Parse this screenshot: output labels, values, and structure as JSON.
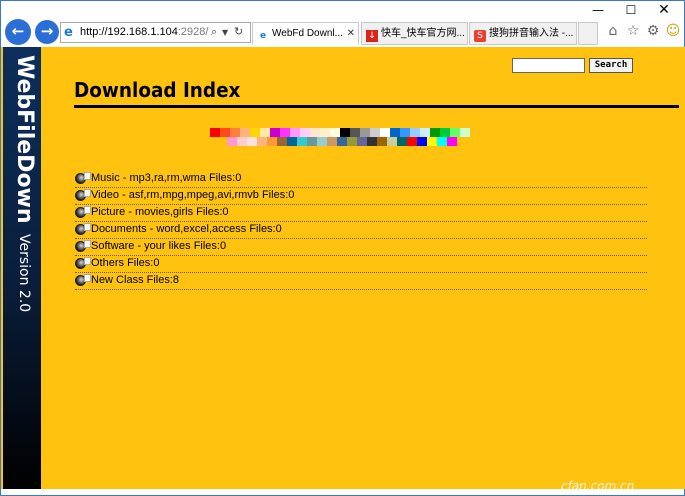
{
  "window": {
    "controls": {
      "minimize": "—",
      "maximize": "☐",
      "close": "✕"
    }
  },
  "toolbar": {
    "back_icon": "←",
    "forward_icon": "→",
    "address": {
      "url_main": "http://192.168.1.104",
      "url_port": ":2928/"
    },
    "tabs": [
      {
        "label": "WebFd Downl...",
        "icon": "page-icon",
        "active": true
      },
      {
        "label": "快车_快车官方网...",
        "icon": "download-icon",
        "active": false
      },
      {
        "label": "搜狗拼音输入法 -...",
        "icon": "sogou-icon",
        "active": false
      }
    ],
    "right_icons": [
      "home-icon",
      "star-icon",
      "gear-icon",
      "smiley-icon"
    ]
  },
  "sidebar": {
    "title": "WebFileDown",
    "version": "Version 2.0"
  },
  "search": {
    "value": "",
    "button_label": "Search"
  },
  "page": {
    "title": "Download Index"
  },
  "palette": {
    "row1": [
      "#ff0000",
      "#ff4a1a",
      "#ff7f3f",
      "#ffb27a",
      "#ffd400",
      "#ffe9a8",
      "#cc00cc",
      "#ff33ff",
      "#ff99ff",
      "#ffccff",
      "#ffe6cc",
      "#fff0cc",
      "#fffbe0",
      "#000000",
      "#555555",
      "#999999",
      "#cccccc",
      "#ffffff",
      "#0066cc",
      "#3399ff",
      "#99ccff",
      "#cceeff",
      "#009900",
      "#00cc33",
      "#66ff66",
      "#ccffcc"
    ],
    "row2": [
      "#ff99cc",
      "#ffcccc",
      "#ffe0e0",
      "#ffb380",
      "#ff9933",
      "#996633",
      "#006699",
      "#33cccc",
      "#669999",
      "#99cccc",
      "#cc9966",
      "#336699",
      "#999933",
      "#666699",
      "#333333",
      "#996600",
      "#cccc99",
      "#006666",
      "#ff0000",
      "#0000ff",
      "#ffff00",
      "#00ffff",
      "#ff00ff"
    ]
  },
  "categories": [
    {
      "label": "Music - mp3,ra,rm,wma Files:0"
    },
    {
      "label": "Video - asf,rm,mpg,mpeg,avi,rmvb Files:0"
    },
    {
      "label": "Picture - movies,girls Files:0"
    },
    {
      "label": "Documents - word,excel,access Files:0"
    },
    {
      "label": "Software - your likes Files:0"
    },
    {
      "label": "Others Files:0"
    },
    {
      "label": "New Class Files:8"
    }
  ],
  "watermark": "cfan.com.cn",
  "colors": {
    "page_bg": "#ffc20e",
    "sidebar": "#0c2f5c",
    "accent": "#2b6fd6"
  }
}
